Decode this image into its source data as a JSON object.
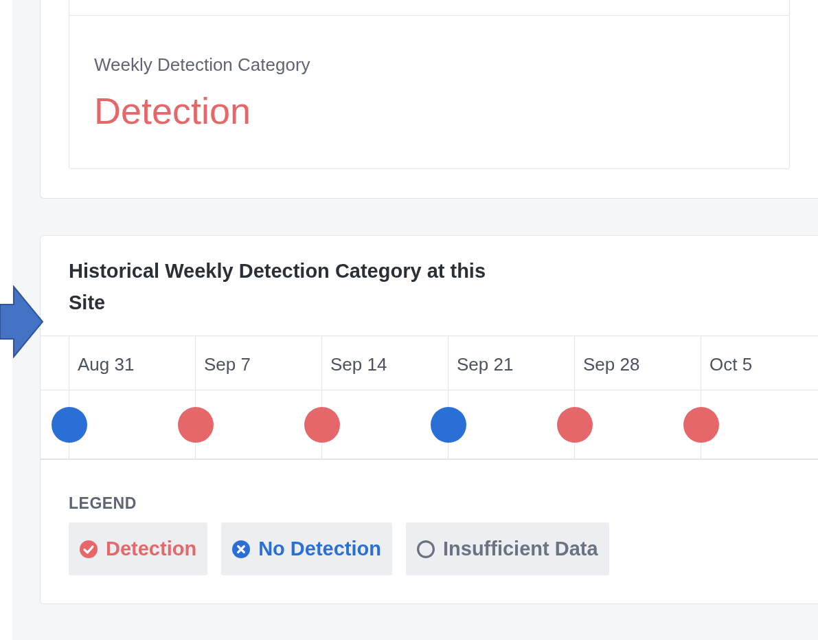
{
  "summary_card": {
    "label": "Weekly Detection Category",
    "value": "Detection",
    "color": "#e5676a"
  },
  "history_card": {
    "title": "Historical Weekly Detection Category at this Site",
    "weeks": [
      {
        "label": "Aug 31",
        "color": "#2a6fd6"
      },
      {
        "label": "Sep 7",
        "color": "#e5676a"
      },
      {
        "label": "Sep 14",
        "color": "#e5676a"
      },
      {
        "label": "Sep 21",
        "color": "#2a6fd6"
      },
      {
        "label": "Sep 28",
        "color": "#e5676a"
      },
      {
        "label": "Oct 5",
        "color": "#e5676a"
      }
    ],
    "legend_title": "LEGEND",
    "legend": [
      {
        "label": "Detection",
        "kind": "check",
        "color": "#e5676a"
      },
      {
        "label": "No Detection",
        "kind": "cross",
        "color": "#2a6fd6"
      },
      {
        "label": "Insufficient Data",
        "kind": "empty",
        "color": "#6b7280"
      }
    ]
  }
}
